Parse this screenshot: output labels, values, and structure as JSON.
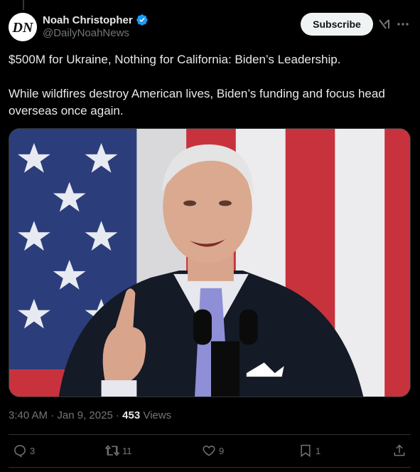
{
  "author": {
    "display_name": "Noah Christopher",
    "handle": "@DailyNoahNews",
    "avatar_initials": "DN"
  },
  "header": {
    "subscribe_label": "Subscribe"
  },
  "tweet": {
    "paragraphs": [
      "$500M for Ukraine, Nothing for California: Biden’s Leadership.",
      "While wildfires destroy American lives, Biden’s funding and focus head overseas once again."
    ]
  },
  "meta": {
    "time": "3:40 AM",
    "separator": " · ",
    "date": "Jan 9, 2025",
    "separator2": " · ",
    "views_count": "453",
    "views_label": " Views"
  },
  "actions": {
    "replies": "3",
    "reposts": "11",
    "likes": "9",
    "bookmarks": "1"
  },
  "colors": {
    "background": "#000000",
    "text_primary": "#e7e9ea",
    "text_secondary": "#71767b",
    "verified": "#1d9bf0",
    "divider": "#2f3336"
  },
  "icons": [
    "verified-icon",
    "grok-icon",
    "more-icon",
    "reply-icon",
    "repost-icon",
    "like-icon",
    "bookmark-icon",
    "share-icon"
  ]
}
